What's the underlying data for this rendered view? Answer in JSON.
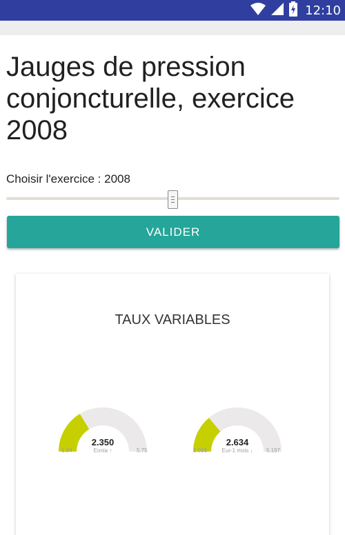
{
  "status_bar": {
    "time": "12:10",
    "icons": [
      "wifi-icon",
      "signal-icon",
      "battery-icon"
    ],
    "color": "#303f9f"
  },
  "page": {
    "title": "Jauges de pression conjoncturelle, exercice 2008"
  },
  "year_selector": {
    "label": "Choisir l'exercice : 2008",
    "value": 2008
  },
  "validate_button": {
    "label": "VALIDER",
    "color": "#26a69a"
  },
  "card": {
    "title": "TAUX VARIABLES",
    "gauges": [
      {
        "value": "2.350",
        "label": "Eonia ↑",
        "min": "1.34",
        "max": "5.75",
        "fill_color": "#c6cf00",
        "track_color": "#ece9ea"
      },
      {
        "value": "2.634",
        "label": "Eur-1 mois ↓",
        "min": "2.016",
        "max": "5.197",
        "fill_color": "#c6cf00",
        "track_color": "#ece9ea"
      }
    ]
  }
}
